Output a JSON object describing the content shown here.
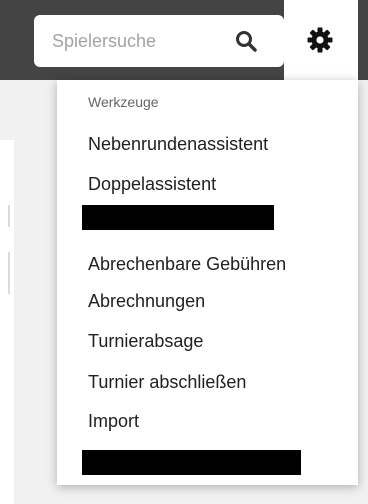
{
  "search": {
    "placeholder": "Spielersuche",
    "value": ""
  },
  "icons": {
    "search": "search-icon",
    "settings": "gear-icon"
  },
  "colors": {
    "topbar": "#444444",
    "menu_text": "#212121",
    "heading_text": "#666666"
  },
  "menu": {
    "heading": "Werkzeuge",
    "items": [
      "Nebenrundenassistent",
      "Doppelassistent",
      "Abrechenbare Gebühren",
      "Abrechnungen",
      "Turnierabsage",
      "Turnier abschließen",
      "Import"
    ]
  }
}
